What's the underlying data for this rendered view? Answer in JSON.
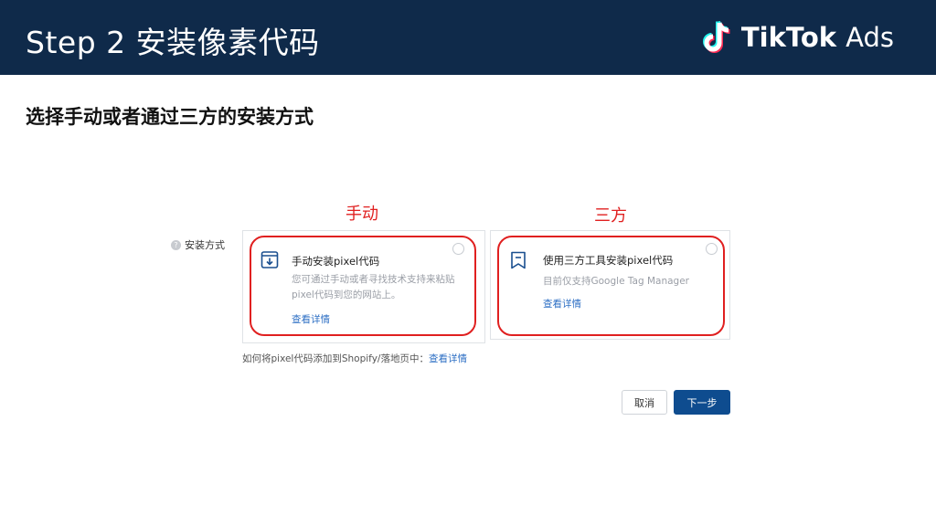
{
  "header": {
    "title": "Step 2 安装像素代码",
    "brand": {
      "name": "TikTok",
      "suffix": "Ads",
      "icon": "tiktok-note-icon"
    }
  },
  "subheading": "选择手动或者通过三方的安装方式",
  "annotations": {
    "manual": "手动",
    "third_party": "三方",
    "highlight_color": "#e02020"
  },
  "form": {
    "label": "安装方式",
    "label_icon": "help-circle-icon",
    "options": [
      {
        "title": "手动安装pixel代码",
        "description": "您可通过手动或者寻找技术支持来粘贴pixel代码到您的网站上。",
        "link": "查看详情",
        "icon": "download-box-icon",
        "selected": false
      },
      {
        "title": "使用三方工具安装pixel代码",
        "description": "目前仅支持Google Tag Manager",
        "link": "查看详情",
        "icon": "bookmark-icon",
        "selected": false
      }
    ],
    "help_text": "如何将pixel代码添加到Shopify/落地页中：",
    "help_link": "查看详情"
  },
  "buttons": {
    "cancel": "取消",
    "next": "下一步"
  },
  "colors": {
    "header_bg": "#0f2a4a",
    "primary": "#0e4c8f",
    "link": "#2d6fc4"
  }
}
